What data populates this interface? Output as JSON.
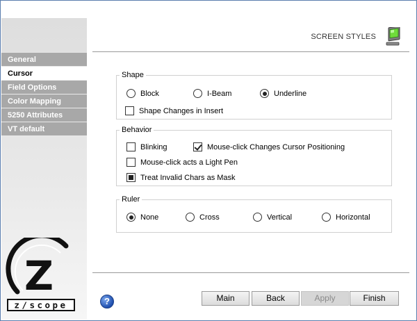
{
  "header": {
    "title": "SCREEN STYLES",
    "icon": "monitor-icon"
  },
  "sidebar": {
    "items": [
      {
        "label": "General",
        "active": false
      },
      {
        "label": "Cursor",
        "active": true
      },
      {
        "label": "Field Options",
        "active": false
      },
      {
        "label": "Color Mapping",
        "active": false
      },
      {
        "label": "5250 Attributes",
        "active": false
      },
      {
        "label": "VT default",
        "active": false
      }
    ],
    "logo": {
      "letter": "Z",
      "wordmark": "z/scope"
    }
  },
  "shape": {
    "legend": "Shape",
    "options": [
      {
        "label": "Block",
        "selected": false
      },
      {
        "label": "I-Beam",
        "selected": false
      },
      {
        "label": "Underline",
        "selected": true
      }
    ],
    "changes_in_insert": {
      "label": "Shape Changes in Insert",
      "checked": false
    }
  },
  "behavior": {
    "legend": "Behavior",
    "blinking": {
      "label": "Blinking",
      "checked": false
    },
    "mouse_click_positioning": {
      "label": "Mouse-click Changes Cursor Positioning",
      "checked": true
    },
    "light_pen": {
      "label": "Mouse-click acts a Light Pen",
      "checked": false
    },
    "invalid_chars_mask": {
      "label": "Treat Invalid Chars as Mask",
      "checked": true
    }
  },
  "ruler": {
    "legend": "Ruler",
    "options": [
      {
        "label": "None",
        "selected": true
      },
      {
        "label": "Cross",
        "selected": false
      },
      {
        "label": "Vertical",
        "selected": false
      },
      {
        "label": "Horizontal",
        "selected": false
      }
    ]
  },
  "footer": {
    "help_label": "?",
    "main_label": "Main",
    "back_label": "Back",
    "apply_label": "Apply",
    "apply_enabled": false,
    "finish_label": "Finish"
  },
  "colors": {
    "nav_inactive": "#a8a8a8",
    "nav_active": "#ffffff",
    "window_border": "#5a7dae"
  }
}
